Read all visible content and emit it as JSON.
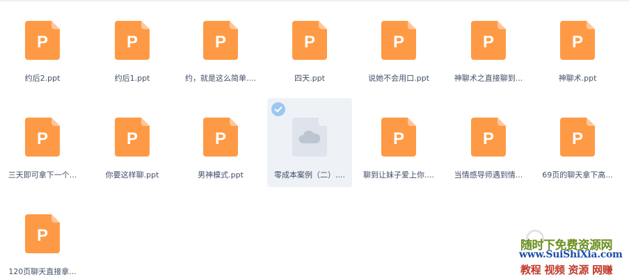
{
  "files": [
    {
      "name": "约后2.ppt",
      "type": "ppt",
      "glyph": "P"
    },
    {
      "name": "约后1.ppt",
      "type": "ppt",
      "glyph": "P"
    },
    {
      "name": "约，就是这么简单....",
      "type": "ppt",
      "glyph": "P"
    },
    {
      "name": "四天.ppt",
      "type": "ppt",
      "glyph": "P"
    },
    {
      "name": "说她不会用口.ppt",
      "type": "ppt",
      "glyph": "P"
    },
    {
      "name": "神聊术之直接聊到...",
      "type": "ppt",
      "glyph": "P"
    },
    {
      "name": "神聊术.ppt",
      "type": "ppt",
      "glyph": "P"
    },
    {
      "name": "三天即可拿下一个...",
      "type": "ppt",
      "glyph": "P"
    },
    {
      "name": "你要这样聊.ppt",
      "type": "ppt",
      "glyph": "P"
    },
    {
      "name": "男神模式.ppt",
      "type": "ppt",
      "glyph": "P"
    },
    {
      "name": "零成本案例（二）....",
      "type": "cloud",
      "selected": true
    },
    {
      "name": "聊到让妹子爱上你....",
      "type": "ppt",
      "glyph": "P"
    },
    {
      "name": "当情感导师遇到情...",
      "type": "ppt",
      "glyph": "P"
    },
    {
      "name": "69页的聊天拿下高...",
      "type": "ppt",
      "glyph": "P"
    },
    {
      "name": "120页聊天直接拿...",
      "type": "ppt",
      "glyph": "P"
    }
  ],
  "icons": {
    "ppt": "ppt-file-icon",
    "cloud": "cloud-file-icon",
    "check": "check-circle-icon"
  },
  "watermark": {
    "line1": "随时下免费资源网",
    "line2": "www.SuiShiXia.com",
    "line3": "教程 视频 资源 网赚"
  },
  "colors": {
    "ppt_orange": "#fe9a45",
    "ppt_fold": "#ffc59a",
    "cloud_tile": "#dfe4ec",
    "cloud_mark": "#bcc6d3",
    "selected_bg": "#eef2f7",
    "check_blue": "#9cc7f0",
    "label": "#424e67"
  }
}
